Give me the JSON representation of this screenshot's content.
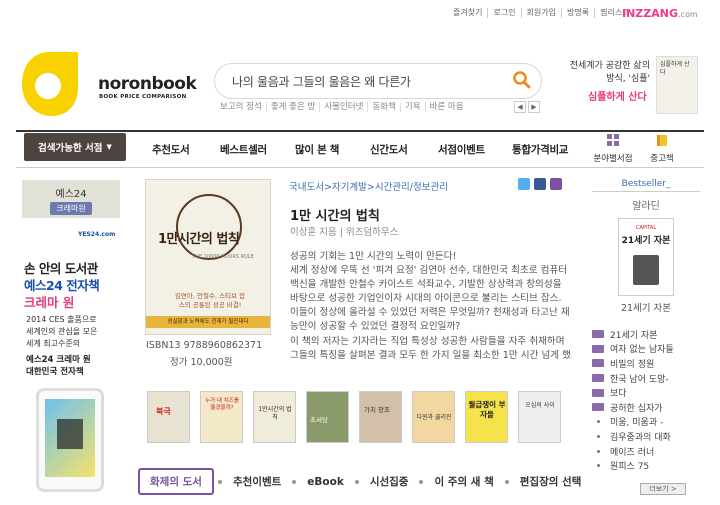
{
  "top_links": [
    "즐겨찾기",
    "로그인",
    "회원가입",
    "방명록",
    "찜리스트"
  ],
  "inzzang": {
    "name": "INZZANG",
    "suffix": ".com"
  },
  "logo": {
    "name": "noronbook",
    "sub": "BOOK PRICE COMPARISON"
  },
  "search": {
    "value": "나의 울음과 그들의 울음은 왜 다른가"
  },
  "hot_words": [
    "보고의 정석",
    "좋게 좋은 방",
    "사물인터넷",
    "동화책",
    "기욕",
    "바른 마음"
  ],
  "top_ad": {
    "line1": "전세계가 공감한 삶의 방식, '심플'",
    "line2": "심플하게 산다",
    "book_title": "심플하게 산다"
  },
  "nav": {
    "selector": "검색가능한 서점",
    "items": [
      "추천도서",
      "베스트셀러",
      "많이 본 책",
      "신간도서",
      "서점이벤트",
      "통합가격비교"
    ],
    "icon_items": [
      "분야별서점",
      "중고책"
    ]
  },
  "left_banner": {
    "top1": "예스24",
    "top2": "크레마원",
    "logo": "YES24.com",
    "headline1": "손 안의 도서관",
    "headline2": "예스24 전자책",
    "headline3": "크레마 원",
    "body1": "2014 CES 출품으로",
    "body2": "세계인의 관심을 모은",
    "body3": "세계 최고수준의",
    "body4": "예스24 크레마 원",
    "body5": "대한민국 전자책"
  },
  "book": {
    "breadcrumb": "국내도서>자기계발>시간관리/정보관리",
    "title": "1만 시간의 법칙",
    "author": "이상훈 지음 | 위즈덤하우스",
    "cover_title": "1만시간의 법칙",
    "cover_en": "THE 10000 HOURS RULE",
    "cover_blurb": "김연아, 안철수, 스티브 잡스의 공통된 성공 비결!",
    "cover_band": "성실함과 노력에도 천재가 될진대다",
    "isbn": "ISBN13 9788960862371",
    "price": "정가 10,000원",
    "description": [
      "성공의 기회는 1만 시간의 노력이 만든다!",
      "세계 정상에 우뚝 선 '피겨 요정' 김연아 선수, 대한민국 최초로 컴퓨터",
      "백신을 개발한 안철수 카이스트 석좌교수, 기발한 상상력과 창의성을",
      "바탕으로 성공한 기업인이자 시대의 아이콘으로 불리는 스티브 잡스.",
      "이들이 정상에 올라설 수 있었던 저력은 무엇일까? 천재성과 타고난 재",
      "능만이 성공할 수 있었던 결정적 요인일까?",
      "이 책의 저자는 기자라는 직업 특성상 성공한 사람들을 자주 취재하며",
      "그들의 특징을 살펴본 결과 모두 한 가지 일을 최소한 1만 시간 넘게 했"
    ]
  },
  "related_thumbs": [
    "북극",
    "누가 내 치즈를 옮겼을까?",
    "1만시간의 법칙",
    "초서당",
    "가치 창조",
    "다윈과 끓리진",
    "월급쟁이 부자들",
    "오십의 사이"
  ],
  "tabs": [
    "화제의 도서",
    "추천이벤트",
    "eBook",
    "시선집중",
    "이 주의 새 책",
    "편집장의 선택"
  ],
  "bestseller": {
    "title": "Bestseller_",
    "site": "알라딘",
    "book": "21세기 자본",
    "cover_label": "CAPITAL",
    "cover_title": "21세기 자본"
  },
  "bestseller_list": [
    "21세기 자본",
    "여자 없는 남자들",
    "비밀의 정원",
    "한국 남어 도망-",
    "보다",
    "공허한 십자가",
    "미움, 미움과 -",
    "김우중과의 대화",
    "메이즈 러너",
    "원피스 75"
  ],
  "more_label": "더보기 >",
  "colors": {
    "accent": "#7a52a1",
    "logo_yellow": "#f7d200",
    "pink": "#e63b7a",
    "link_blue": "#3b6db3"
  }
}
